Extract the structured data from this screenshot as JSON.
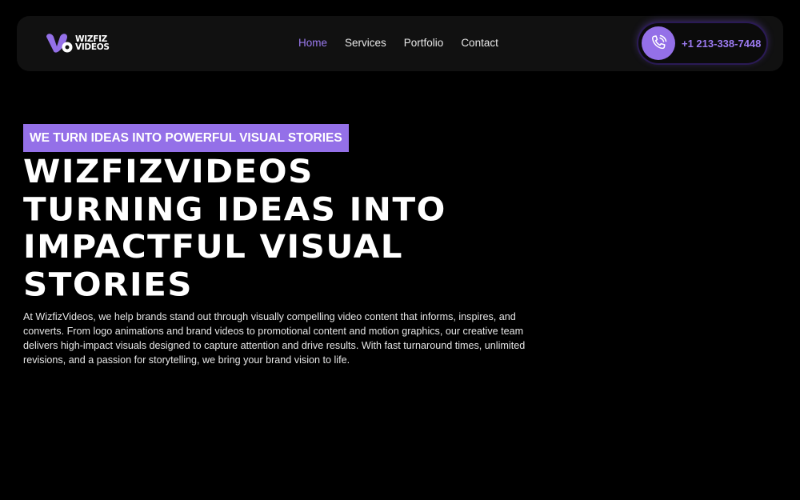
{
  "brand": {
    "logo_line1": "WIZFIZ",
    "logo_line2": "VIDEOS",
    "accent_color": "#9470e8"
  },
  "nav": {
    "items": [
      {
        "label": "Home",
        "active": true
      },
      {
        "label": "Services",
        "active": false
      },
      {
        "label": "Portfolio",
        "active": false
      },
      {
        "label": "Contact",
        "active": false
      }
    ],
    "phone": "+1 213-338-7448",
    "phone_icon": "phone-call-icon"
  },
  "hero": {
    "tagline": "WE TURN IDEAS INTO POWERFUL VISUAL STORIES",
    "headline_lines": [
      "WIZFIZVIDEOS",
      "TURNING IDEAS INTO",
      "IMPACTFUL VISUAL",
      "STORIES"
    ],
    "description": "At WizfizVideos, we help brands stand out through visually compelling video content that informs, inspires, and converts. From logo animations and brand videos to promotional content and motion graphics, our creative team delivers high-impact visuals designed to capture attention and drive results. With fast turnaround times, unlimited revisions, and a passion for storytelling, we bring your brand vision to life."
  }
}
